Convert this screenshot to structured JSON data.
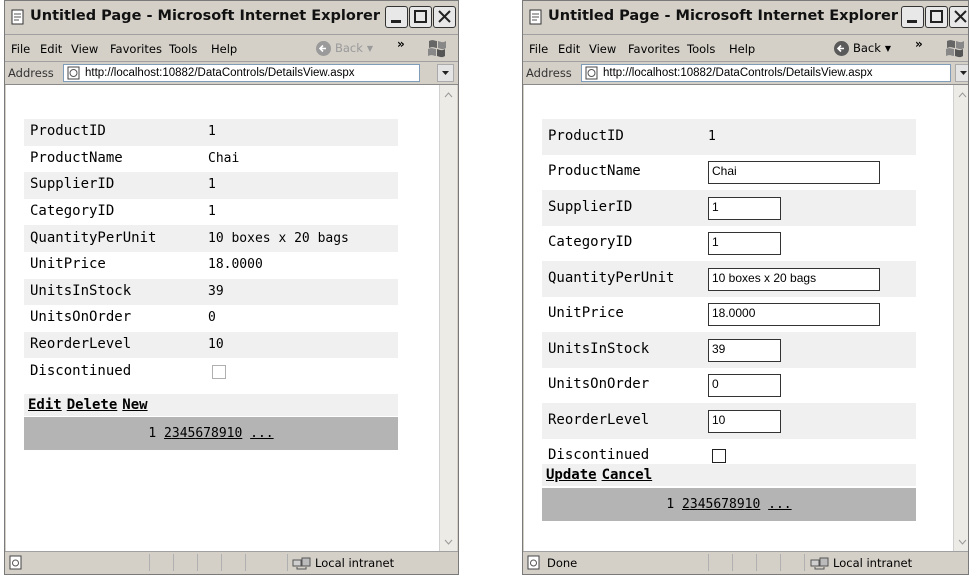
{
  "left_window": {
    "title": "Untitled Page - Microsoft Internet Explorer",
    "menu": [
      "File",
      "Edit",
      "View",
      "Favorites",
      "Tools",
      "Help"
    ],
    "back_label": "Back",
    "address_label": "Address",
    "address_url": "http://localhost:10882/DataControls/DetailsView.aspx",
    "fields": [
      {
        "name": "ProductID",
        "value": "1"
      },
      {
        "name": "ProductName",
        "value": "Chai"
      },
      {
        "name": "SupplierID",
        "value": "1"
      },
      {
        "name": "CategoryID",
        "value": "1"
      },
      {
        "name": "QuantityPerUnit",
        "value": "10 boxes x 20 bags"
      },
      {
        "name": "UnitPrice",
        "value": "18.0000"
      },
      {
        "name": "UnitsInStock",
        "value": "39"
      },
      {
        "name": "UnitsOnOrder",
        "value": "0"
      },
      {
        "name": "ReorderLevel",
        "value": "10"
      },
      {
        "name": "Discontinued",
        "value": ""
      }
    ],
    "actions": [
      "Edit",
      "Delete",
      "New"
    ],
    "pager": [
      "1",
      "2",
      "3",
      "4",
      "5",
      "6",
      "7",
      "8",
      "9",
      "10",
      "..."
    ],
    "status_text": "",
    "zone": "Local intranet"
  },
  "right_window": {
    "title": "Untitled Page - Microsoft Internet Explorer",
    "menu": [
      "File",
      "Edit",
      "View",
      "Favorites",
      "Tools",
      "Help"
    ],
    "back_label": "Back",
    "address_label": "Address",
    "address_url": "http://localhost:10882/DataControls/DetailsView.aspx",
    "fields": [
      {
        "name": "ProductID",
        "value": "1"
      },
      {
        "name": "ProductName",
        "value": "Chai"
      },
      {
        "name": "SupplierID",
        "value": "1"
      },
      {
        "name": "CategoryID",
        "value": "1"
      },
      {
        "name": "QuantityPerUnit",
        "value": "10 boxes x 20 bags"
      },
      {
        "name": "UnitPrice",
        "value": "18.0000"
      },
      {
        "name": "UnitsInStock",
        "value": "39"
      },
      {
        "name": "UnitsOnOrder",
        "value": "0"
      },
      {
        "name": "ReorderLevel",
        "value": "10"
      },
      {
        "name": "Discontinued",
        "value": ""
      }
    ],
    "actions": [
      "Update",
      "Cancel"
    ],
    "pager": [
      "1",
      "2",
      "3",
      "4",
      "5",
      "6",
      "7",
      "8",
      "9",
      "10",
      "..."
    ],
    "status_text": "Done",
    "zone": "Local intranet"
  },
  "icons": [
    "ie-page-icon",
    "minimize-icon",
    "maximize-icon",
    "close-icon",
    "back-arrow-icon",
    "windows-logo-icon",
    "address-page-icon",
    "dropdown-icon",
    "scroll-up-icon",
    "scroll-down-icon",
    "intranet-icon"
  ],
  "colors": {
    "chrome": "#d4d0c8",
    "row_alt": "#f0f0f0",
    "pager_bg": "#b4b4b4"
  }
}
